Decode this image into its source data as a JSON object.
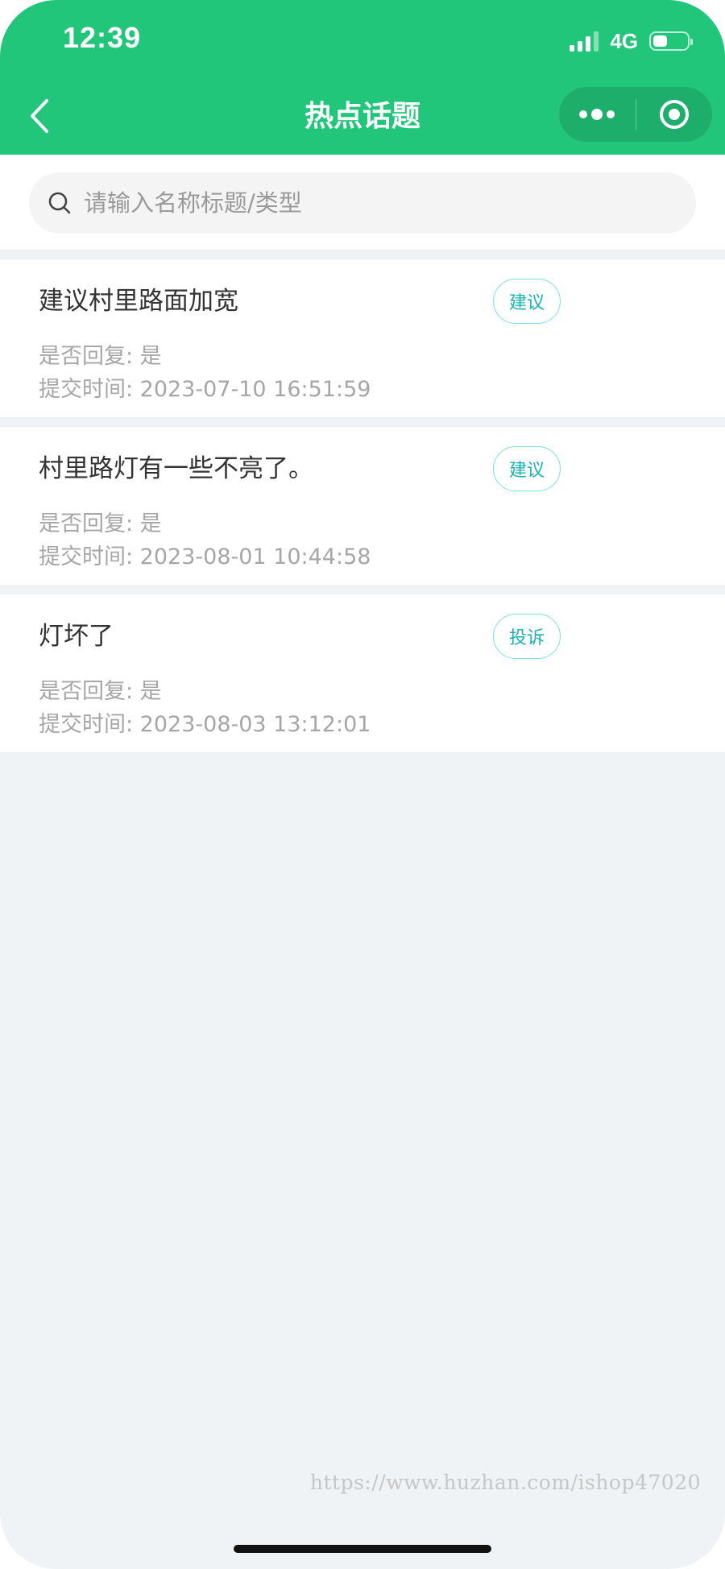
{
  "status_bar": {
    "time": "12:39",
    "network": "4G"
  },
  "header": {
    "title": "热点话题",
    "back_icon": "chevron-left-icon",
    "more_icon": "more-dots-icon",
    "close_icon": "target-circle-icon"
  },
  "search": {
    "placeholder": "请输入名称标题/类型",
    "value": ""
  },
  "list": {
    "items": [
      {
        "title": "建议村里路面加宽",
        "tag": "建议",
        "replied": "是否回复: 是",
        "time": "提交时间: 2023-07-10 16:51:59"
      },
      {
        "title": "村里路灯有一些不亮了。",
        "tag": "建议",
        "replied": "是否回复: 是",
        "time": "提交时间: 2023-08-01 10:44:58"
      },
      {
        "title": "灯坏了",
        "tag": "投诉",
        "replied": "是否回复: 是",
        "time": "提交时间: 2023-08-03 13:12:01"
      }
    ]
  },
  "watermark": "https://www.huzhan.com/ishop47020",
  "colors": {
    "brand": "#22c67a",
    "tag_text": "#19b3b3",
    "tag_border": "#7ee0e0",
    "page_bg": "#eff3f6"
  }
}
